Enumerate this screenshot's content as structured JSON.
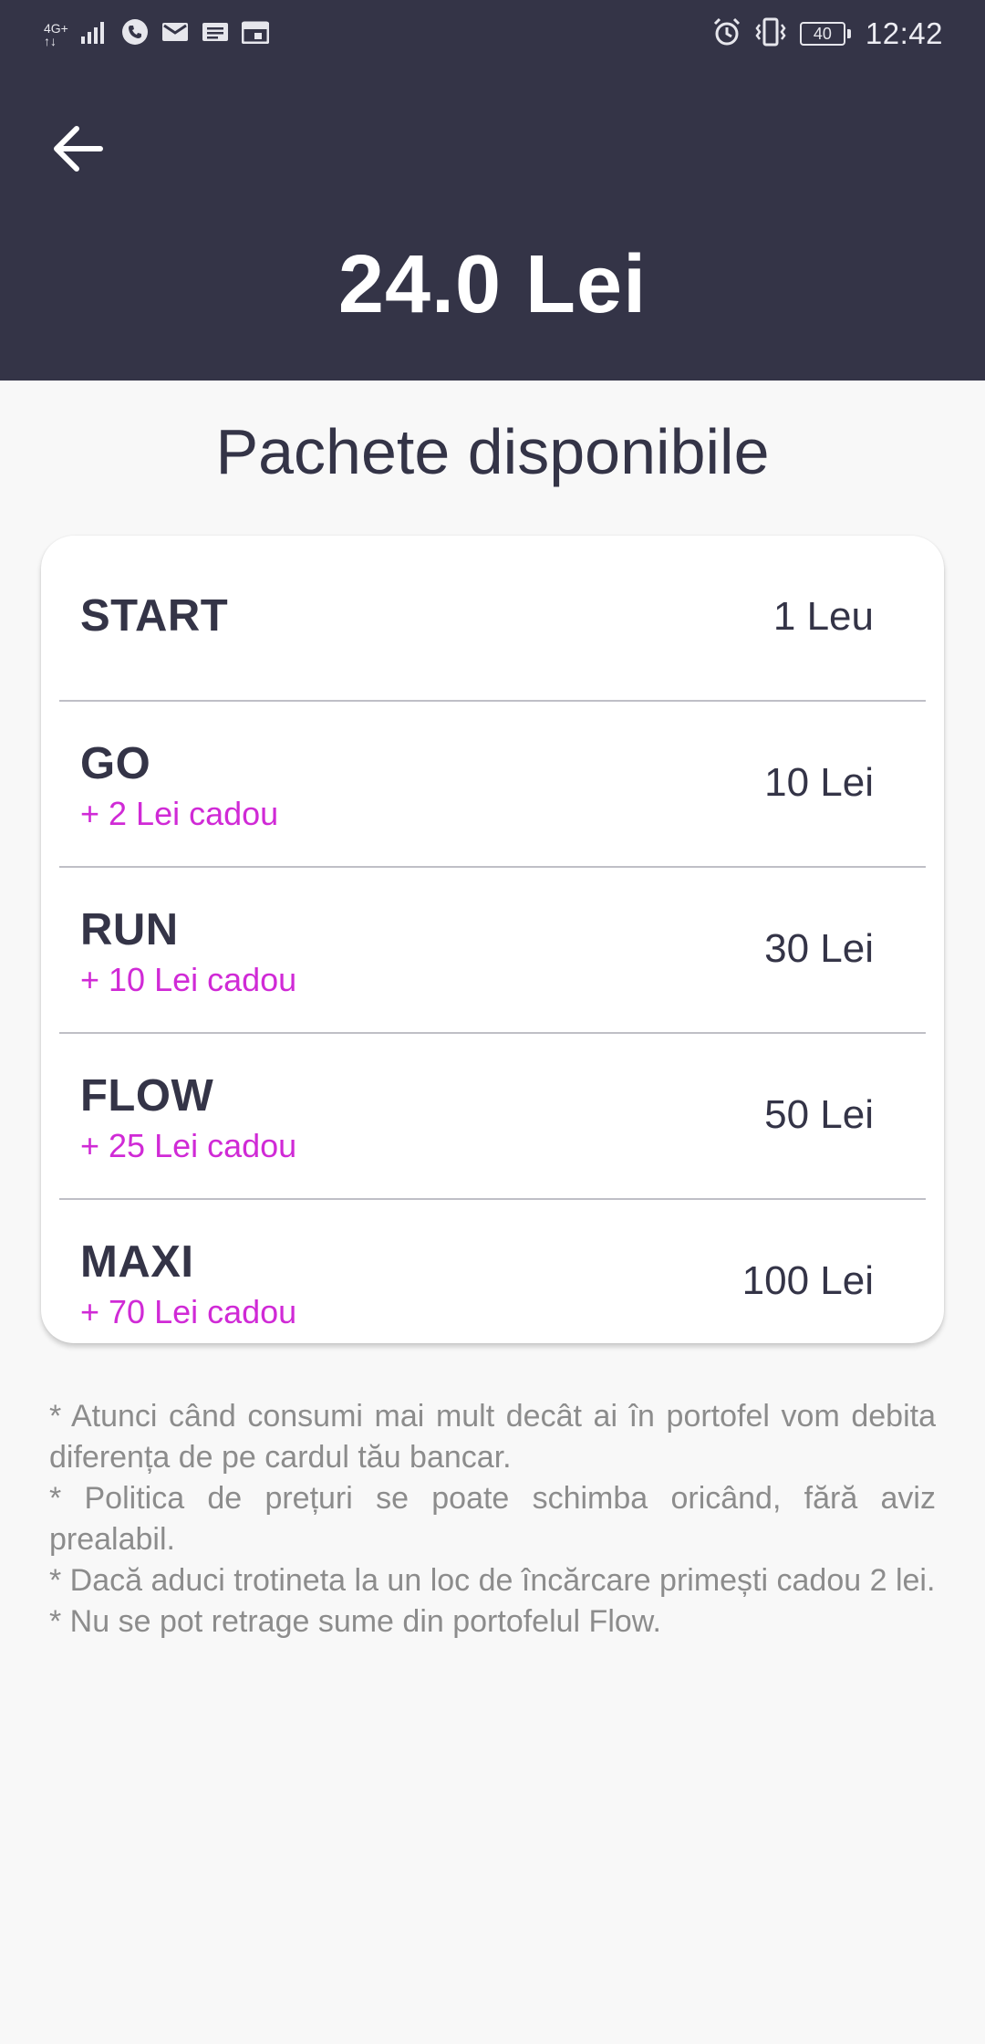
{
  "status_bar": {
    "network_label_top": "4G+",
    "network_label_bottom": "↑↓",
    "icons": [
      "signal-icon",
      "phone-icon",
      "mail-icon",
      "message-icon",
      "calendar-icon",
      "alarm-icon",
      "vibrate-icon",
      "battery-icon"
    ],
    "battery_level": "40",
    "time": "12:42"
  },
  "header": {
    "back_icon": "arrow-left-icon",
    "balance": "24.0 Lei",
    "background_color": "#343447"
  },
  "packages_title": "Pachete disponibile",
  "packages": [
    {
      "name": "START",
      "gift": "",
      "price": "1 Leu"
    },
    {
      "name": "GO",
      "gift": "+ 2 Lei cadou",
      "price": "10 Lei"
    },
    {
      "name": "RUN",
      "gift": "+ 10 Lei cadou",
      "price": "30 Lei"
    },
    {
      "name": "FLOW",
      "gift": "+ 25 Lei cadou",
      "price": "50 Lei"
    },
    {
      "name": "MAXI",
      "gift": "+ 70 Lei cadou",
      "price": "100 Lei"
    }
  ],
  "notes": [
    "* Atunci când consumi mai mult decât ai în portofel vom debita diferența de pe cardul tău bancar.",
    "* Politica de prețuri se poate schimba oricând, fără aviz prealabil.",
    "* Dacă aduci trotineta la un loc de încărcare primești cadou 2 lei.",
    "* Nu se pot retrage sume din portofelul Flow."
  ],
  "colors": {
    "header_bg": "#343447",
    "text_dark": "#343447",
    "gift_accent": "#d02ad6",
    "notes_text": "#8c8c8c",
    "page_bg": "#f8f8f8"
  }
}
